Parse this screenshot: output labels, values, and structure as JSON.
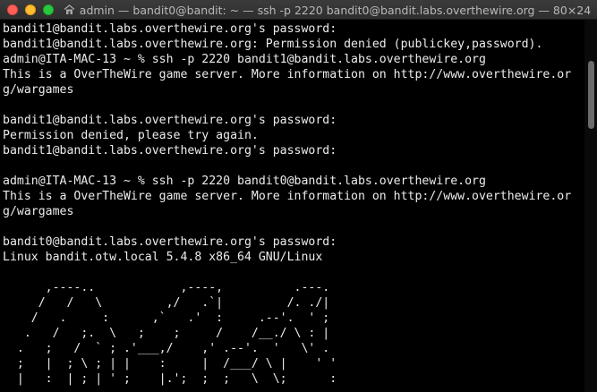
{
  "window": {
    "title": "admin — bandit0@bandit: ~ — ssh -p 2220 bandit0@bandit.labs.overthewire.org — 80×24"
  },
  "terminal": {
    "lines": [
      "bandit1@bandit.labs.overthewire.org's password:",
      "bandit1@bandit.labs.overthewire.org: Permission denied (publickey,password).",
      "admin@ITA-MAC-13 ~ % ssh -p 2220 bandit1@bandit.labs.overthewire.org",
      "This is a OverTheWire game server. More information on http://www.overthewire.or",
      "g/wargames",
      "",
      "bandit1@bandit.labs.overthewire.org's password:",
      "Permission denied, please try again.",
      "bandit1@bandit.labs.overthewire.org's password:",
      "",
      "admin@ITA-MAC-13 ~ % ssh -p 2220 bandit0@bandit.labs.overthewire.org",
      "This is a OverTheWire game server. More information on http://www.overthewire.or",
      "g/wargames",
      "",
      "bandit0@bandit.labs.overthewire.org's password:",
      "Linux bandit.otw.local 5.4.8 x86_64 GNU/Linux",
      "",
      "      ,----..            ,----,          .---.",
      "     /   /   \\         ,/   .`|         /. ./|",
      "    /   .     :      ,`   .'  :     .--'.  ' ;",
      "   .   /   ;.  \\   ;    ;     /    /__./ \\ : |",
      "  .   ;   /  ` ; .'___,/    ,' .--'.  '   \\' .",
      "  ;   |  ; \\ ; | |    :     |  /___/ \\ |    ' '",
      "  |   :  | ; | ' ;    |.';  ;  ;   \\  \\;      :"
    ]
  },
  "colors": {
    "background": "#000000",
    "text": "#ececec",
    "titlebar": "#333333",
    "close": "#ff5f57",
    "minimize": "#febc2e",
    "maximize": "#28c840"
  },
  "icons": {
    "title": "home-folder-icon"
  }
}
